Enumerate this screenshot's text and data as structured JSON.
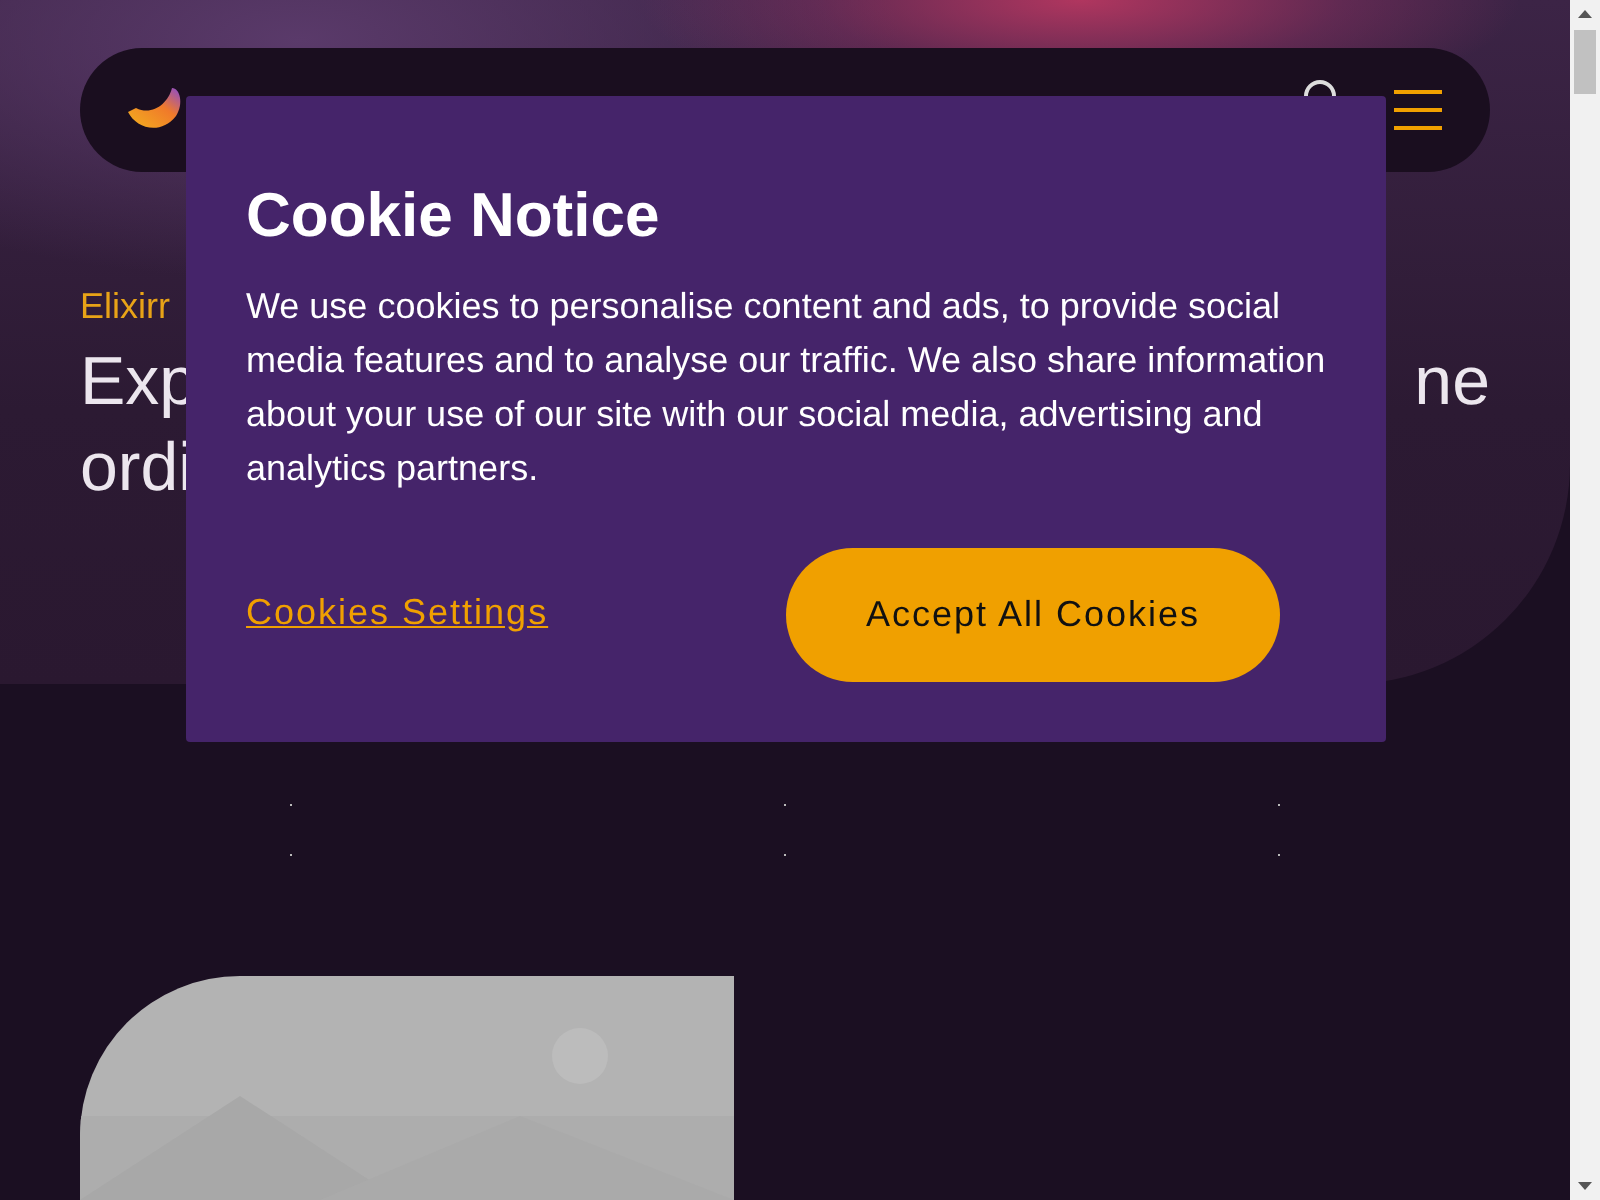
{
  "header": {
    "menu": {
      "kind": "hamburger"
    }
  },
  "hero": {
    "eyebrow": "Elixirr",
    "heading_left": [
      "Exp",
      "ordi"
    ],
    "heading_right": [
      "ne"
    ]
  },
  "cookie_notice": {
    "title": "Cookie Notice",
    "body": "We use cookies to personalise content and ads, to provide social media features and to analyse our traffic. We also share information about your use of our site with our social media, advertising and analytics partners.",
    "settings_link": "Cookies Settings",
    "accept_button": "Accept All Cookies"
  }
}
